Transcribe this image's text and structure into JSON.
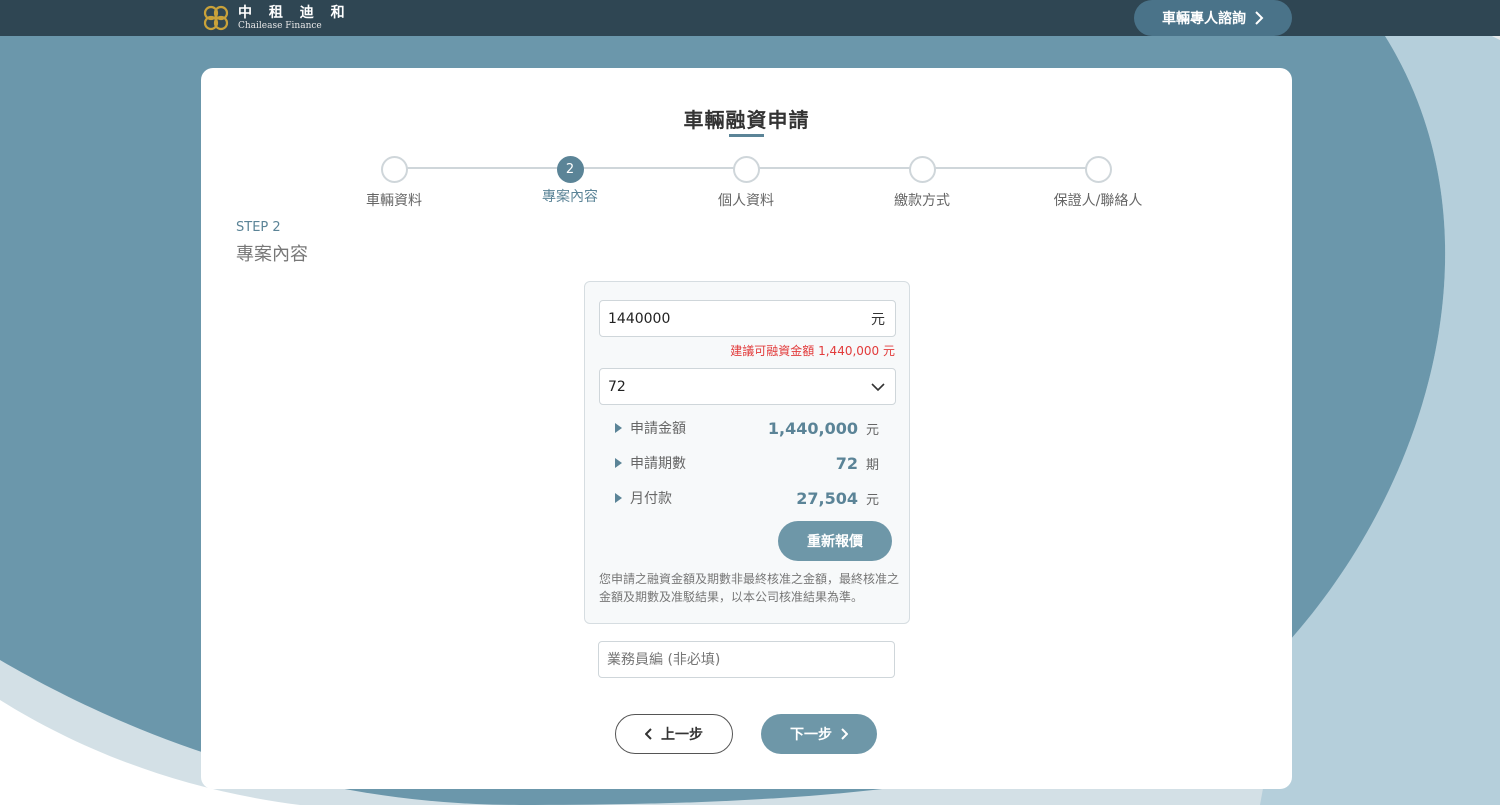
{
  "colors": {
    "header_bg": "#2f4653",
    "accent": "#5b8497",
    "button_bg": "#6e97a8",
    "warning": "#e23b3b",
    "wave_dark": "#6b97ab",
    "wave_light": "#d3e0e6"
  },
  "header": {
    "logo_cn": "中 租 迪 和",
    "logo_en": "Chailease Finance",
    "consult_label": "車輛專人諮詢",
    "consult_icon": "chevron-right-icon"
  },
  "page": {
    "title": "車輛融資申請"
  },
  "stepper": {
    "steps": [
      {
        "label": "車輛資料",
        "number": "",
        "active": false
      },
      {
        "label": "專案內容",
        "number": "2",
        "active": true
      },
      {
        "label": "個人資料",
        "number": "",
        "active": false
      },
      {
        "label": "繳款方式",
        "number": "",
        "active": false
      },
      {
        "label": "保證人/聯絡人",
        "number": "",
        "active": false
      }
    ]
  },
  "section": {
    "step_tag": "STEP 2",
    "heading": "專案內容"
  },
  "form": {
    "amount_value": "1440000",
    "amount_unit": "元",
    "suggestion": "建議可融資金額 1,440,000 元",
    "term_value": "72",
    "term_icon": "chevron-down-icon",
    "summary": [
      {
        "label": "申請金額",
        "value": "1,440,000",
        "unit": "元"
      },
      {
        "label": "申請期數",
        "value": "72",
        "unit": "期"
      },
      {
        "label": "月付款",
        "value": "27,504",
        "unit": "元"
      }
    ],
    "requote_label": "重新報價",
    "disclaimer": "您申請之融資金額及期數非最終核准之金額，最終核准之金額及期數及准駁結果，以本公司核准結果為準。",
    "salesman_placeholder": "業務員編 (非必填)"
  },
  "nav": {
    "prev_label": "上一步",
    "next_label": "下一步"
  }
}
